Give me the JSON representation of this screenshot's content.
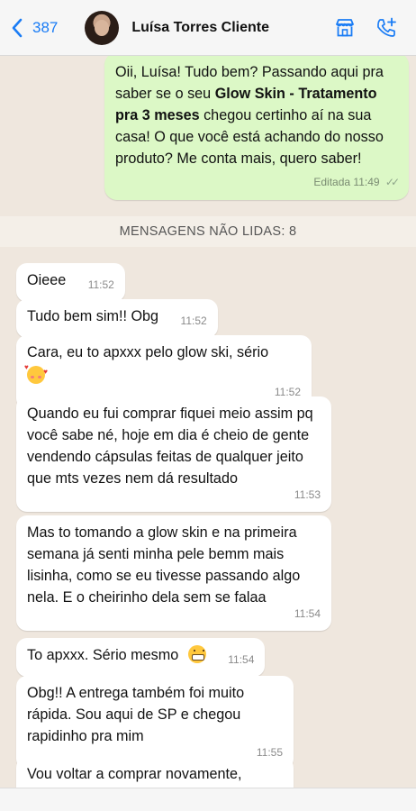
{
  "header": {
    "back_count": "387",
    "contact_name": "Luísa Torres Cliente",
    "icons": [
      "chevron-left-icon",
      "store-icon",
      "phone-add-icon"
    ],
    "accent_color": "#1a7cf5"
  },
  "outgoing": {
    "text_pre": "Oii, Luísa! Tudo bem? Passando aqui pra saber se o seu ",
    "text_bold": "Glow Skin - Tratamento pra 3 meses",
    "text_post": " chegou certinho aí na sua casa! O que você está achando do nosso produto? Me conta mais, quero saber!",
    "edited_label": "Editada",
    "time": "11:49",
    "status": "✓✓"
  },
  "unread_label": "MENSAGENS NÃO LIDAS: 8",
  "incoming": [
    {
      "text": "Oieee",
      "time": "11:52"
    },
    {
      "text": "Tudo bem sim!! Obg",
      "time": "11:52"
    },
    {
      "text": "Cara, eu to apxxx pelo glow ski, sério",
      "time": "11:52",
      "emoji": "smiling-face-with-hearts"
    },
    {
      "text": "Quando eu fui comprar fiquei meio assim pq você sabe né, hoje em dia é cheio de gente vendendo cápsulas feitas de qualquer jeito que mts vezes nem dá resultado",
      "time": "11:53"
    },
    {
      "text": "Mas to tomando a glow skin e na primeira semana já senti minha pele bemm mais lisinha, como se eu tivesse passando algo nela. E o cheirinho dela sem se falaa",
      "time": "11:54"
    },
    {
      "text": "To apxxx. Sério mesmo",
      "time": "11:54",
      "emoji": "grimacing-face"
    },
    {
      "text": "Obg!! A entrega também foi muito rápida. Sou aqui de SP e chegou rapidinho pra mim",
      "time": "11:55"
    },
    {
      "text": "Vou voltar a comprar novamente,",
      "time": ""
    }
  ],
  "colors": {
    "chat_bg": "#efe7de",
    "outgoing_bubble": "#dcf8c6",
    "incoming_bubble": "#ffffff"
  }
}
